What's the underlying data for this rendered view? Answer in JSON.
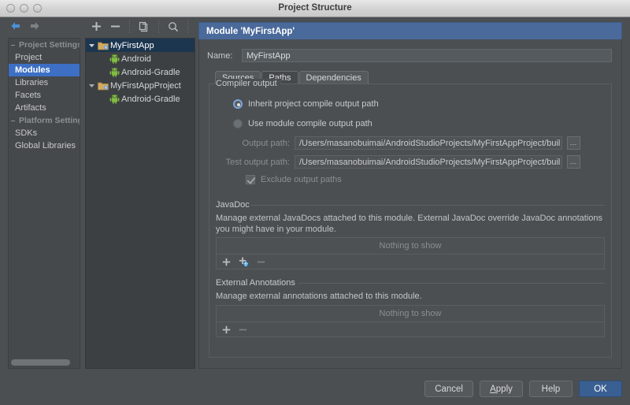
{
  "window": {
    "title": "Project Structure",
    "traffic_lights": [
      "close-button",
      "minimize-button",
      "zoom-button"
    ]
  },
  "toolbar": {
    "back_icon": "arrow-left-icon",
    "forward_icon": "arrow-right-icon",
    "add_icon": "plus-icon",
    "remove_icon": "minus-icon",
    "copy_icon": "copy-icon",
    "search_icon": "search-icon",
    "overflow_label": "»"
  },
  "sidebar": {
    "items": [
      {
        "label": "Project Settings",
        "type": "group",
        "selected": false
      },
      {
        "label": "Project",
        "type": "item",
        "selected": false
      },
      {
        "label": "Modules",
        "type": "item",
        "selected": true
      },
      {
        "label": "Libraries",
        "type": "item",
        "selected": false
      },
      {
        "label": "Facets",
        "type": "item",
        "selected": false
      },
      {
        "label": "Artifacts",
        "type": "item",
        "selected": false
      },
      {
        "label": "Platform Settings",
        "type": "group",
        "selected": false
      },
      {
        "label": "SDKs",
        "type": "item",
        "selected": false
      },
      {
        "label": "Global Libraries",
        "type": "item",
        "selected": false
      }
    ]
  },
  "tree": {
    "nodes": [
      {
        "label": "MyFirstApp",
        "icon": "folder-module-icon",
        "indent": 0,
        "expanded": true,
        "selected": true
      },
      {
        "label": "Android",
        "icon": "android-facet-icon",
        "indent": 1,
        "expanded": null,
        "selected": false
      },
      {
        "label": "Android-Gradle",
        "icon": "android-facet-icon",
        "indent": 1,
        "expanded": null,
        "selected": false
      },
      {
        "label": "MyFirstAppProject",
        "icon": "folder-module-icon",
        "indent": 0,
        "expanded": true,
        "selected": false
      },
      {
        "label": "Android-Gradle",
        "icon": "android-facet-icon",
        "indent": 1,
        "expanded": null,
        "selected": false
      }
    ]
  },
  "editor": {
    "header": "Module 'MyFirstApp'",
    "name_label": "Name:",
    "name_value": "MyFirstApp",
    "tabs": [
      {
        "label": "Sources",
        "active": false
      },
      {
        "label": "Paths",
        "active": true
      },
      {
        "label": "Dependencies",
        "active": false
      }
    ],
    "compiler_output": {
      "title": "Compiler output",
      "inherit_label": "Inherit project compile output path",
      "inherit_selected": true,
      "module_label": "Use module compile output path",
      "module_selected": false,
      "output_path_label": "Output path:",
      "output_path_value": "/Users/masanobuimai/AndroidStudioProjects/MyFirstAppProject/buil",
      "test_output_path_label": "Test output path:",
      "test_output_path_value": "/Users/masanobuimai/AndroidStudioProjects/MyFirstAppProject/buil",
      "browse_label": "…",
      "exclude_label": "Exclude output paths",
      "exclude_checked": true
    },
    "javadoc": {
      "title": "JavaDoc",
      "description": "Manage external JavaDocs attached to this module. External JavaDoc override JavaDoc annotations you might have in your module.",
      "empty_text": "Nothing to show",
      "buttons": [
        {
          "name": "add-javadoc-button",
          "glyph": "+"
        },
        {
          "name": "add-javadoc-url-button",
          "glyph": "+"
        },
        {
          "name": "remove-javadoc-button",
          "glyph": "−"
        }
      ]
    },
    "external_annotations": {
      "title": "External Annotations",
      "description": "Manage external annotations attached to this module.",
      "empty_text": "Nothing to show",
      "buttons": [
        {
          "name": "add-annotation-button",
          "glyph": "+"
        },
        {
          "name": "remove-annotation-button",
          "glyph": "−"
        }
      ]
    }
  },
  "footer": {
    "cancel": "Cancel",
    "apply_prefix": "A",
    "apply_rest": "pply",
    "help": "Help",
    "ok": "OK"
  },
  "colors": {
    "accent_blue": "#4a6a9b",
    "selection_blue": "#3d6fc4",
    "tree_selection": "#1d3650",
    "ok_button": "#3a5f93",
    "window_bg": "#4b4f52",
    "android_green": "#82bb41"
  }
}
